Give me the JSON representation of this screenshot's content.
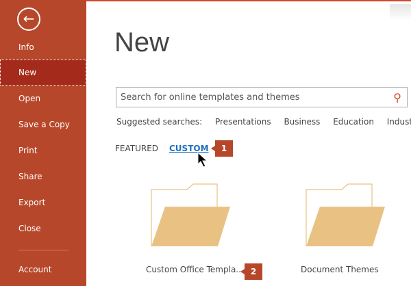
{
  "sidebar": {
    "back_label": "Back",
    "items": [
      {
        "label": "Info"
      },
      {
        "label": "New",
        "selected": true
      },
      {
        "label": "Open"
      },
      {
        "label": "Save a Copy"
      },
      {
        "label": "Print"
      },
      {
        "label": "Share"
      },
      {
        "label": "Export"
      },
      {
        "label": "Close"
      },
      {
        "label": "Account"
      }
    ]
  },
  "main": {
    "title": "New",
    "search": {
      "placeholder": "Search for online templates and themes",
      "value": ""
    },
    "suggested": {
      "label": "Suggested searches:",
      "items": [
        "Presentations",
        "Business",
        "Education",
        "Industry"
      ]
    },
    "tabs": [
      {
        "label": "FEATURED"
      },
      {
        "label": "CUSTOM",
        "active": true
      }
    ],
    "folders": [
      {
        "label": "Custom Office Templa..."
      },
      {
        "label": "Document Themes"
      }
    ]
  },
  "callouts": [
    "1",
    "2"
  ],
  "colors": {
    "accent": "#b7472a",
    "link": "#1c6fbf",
    "folder": "#e9c283"
  }
}
